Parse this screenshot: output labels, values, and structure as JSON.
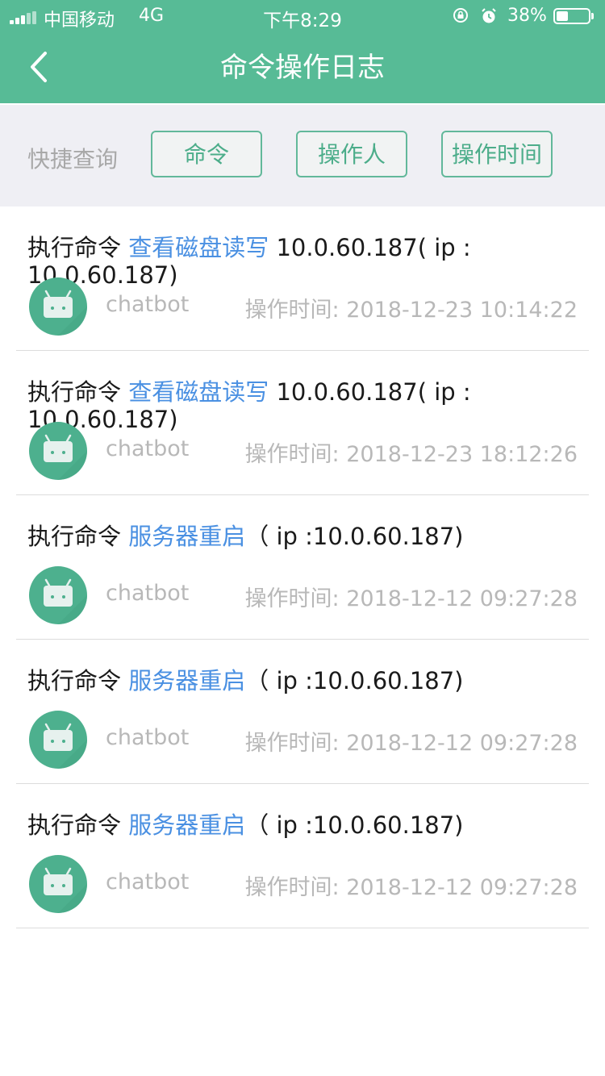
{
  "status_bar": {
    "carrier": "中国移动",
    "network": "4G",
    "time": "下午8:29",
    "battery": "38%",
    "battery_level": 0.38
  },
  "nav": {
    "title": "命令操作日志",
    "back_icon": "chevron-left-icon"
  },
  "filter": {
    "label": "快捷查询",
    "chips": [
      "命令",
      "操作人",
      "操作时间"
    ]
  },
  "log_entries": [
    {
      "prefix": "执行命令 ",
      "command": "查看磁盘读写",
      "detail": "  10.0.60.187( ip : 10.0.60.187)",
      "user": "chatbot",
      "time": "操作时间: 2018-12-23 10:14:22"
    },
    {
      "prefix": "执行命令 ",
      "command": "查看磁盘读写",
      "detail": "  10.0.60.187( ip : 10.0.60.187)",
      "user": "chatbot",
      "time": "操作时间: 2018-12-23 18:12:26"
    },
    {
      "prefix": "执行命令 ",
      "command": "服务器重启",
      "detail": "（ ip :10.0.60.187)",
      "user": "chatbot",
      "time": "操作时间: 2018-12-12 09:27:28"
    },
    {
      "prefix": "执行命令 ",
      "command": "服务器重启",
      "detail": "（ ip :10.0.60.187)",
      "user": "chatbot",
      "time": "操作时间: 2018-12-12 09:27:28"
    },
    {
      "prefix": "执行命令 ",
      "command": "服务器重启",
      "detail": "（ ip :10.0.60.187)",
      "user": "chatbot",
      "time": "操作时间: 2018-12-12 09:27:28"
    }
  ],
  "colors": {
    "primary": "#57bb96",
    "link": "#4a90e2",
    "muted": "#b8b8b8"
  }
}
